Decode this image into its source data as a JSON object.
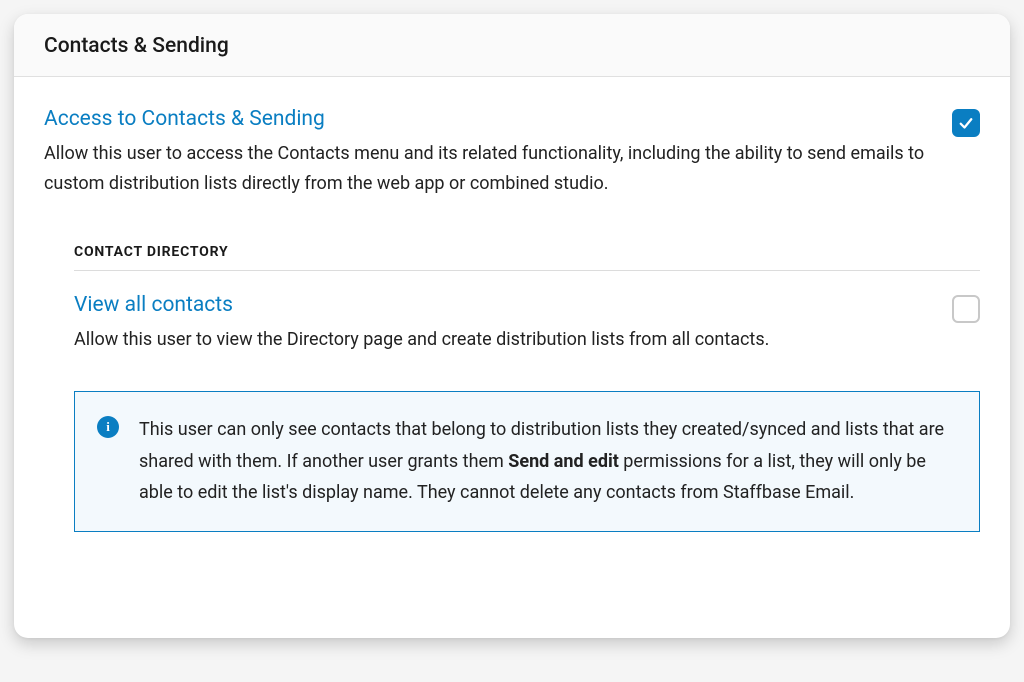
{
  "panel": {
    "title": "Contacts & Sending"
  },
  "access": {
    "title": "Access to Contacts & Sending",
    "description": "Allow this user to access the Contacts menu and its related functionality, including the ability to send emails to custom distribution lists directly from the web app or combined studio.",
    "checked": true
  },
  "directory": {
    "header": "CONTACT DIRECTORY",
    "viewAll": {
      "title": "View all contacts",
      "description": "Allow this user to view the Directory page and create distribution lists from all contacts.",
      "checked": false
    },
    "info": {
      "part1": "This user can only see contacts that belong to distribution lists they created/synced and lists that are shared with them. If another user grants them ",
      "strong": "Send and edit",
      "part2": " permissions for a list, they will only be able to edit the list's display name. They cannot delete any contacts from Staffbase Email."
    }
  }
}
